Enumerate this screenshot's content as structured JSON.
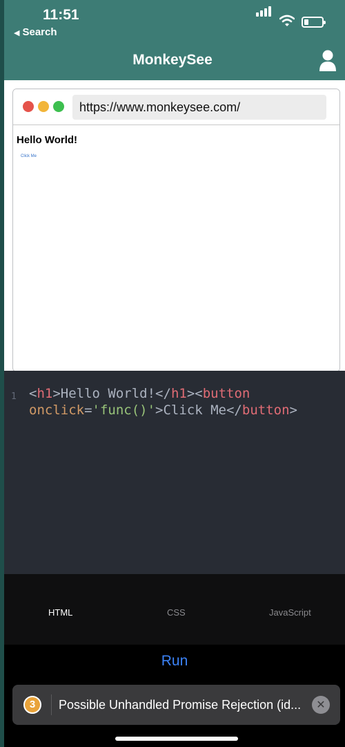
{
  "status": {
    "time": "11:51",
    "back_label": "Search"
  },
  "nav": {
    "title": "MonkeySee"
  },
  "browser": {
    "url": "https://www.monkeysee.com/",
    "dots": [
      "#e5534b",
      "#f2b53a",
      "#3dbf4f"
    ],
    "page_heading": "Hello World!",
    "page_button": "Click Me"
  },
  "editor": {
    "line_number": "1",
    "code": {
      "t1": "<",
      "t2": "h1",
      "t3": ">Hello World!</",
      "t4": "h1",
      "t5": "><",
      "t6": "button",
      "t7": "onclick",
      "t8": "=",
      "t9": "'func()'",
      "t10": ">Click Me</",
      "t11": "button",
      "t12": ">"
    }
  },
  "tabs": {
    "items": [
      "HTML",
      "CSS",
      "JavaScript"
    ],
    "active": "HTML"
  },
  "run_label": "Run",
  "toast": {
    "count": "3",
    "message": "Possible Unhandled Promise Rejection (id..."
  },
  "colors": {
    "accent": "#3b82f6",
    "header": "#3d7c75",
    "editor_bg": "#282c34"
  }
}
